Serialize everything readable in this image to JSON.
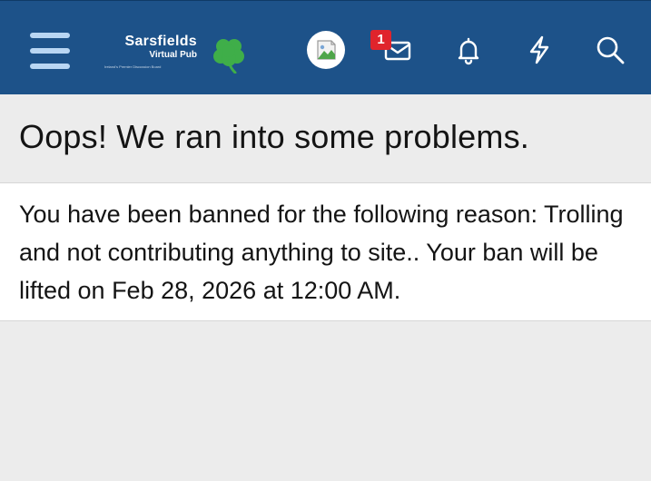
{
  "header": {
    "logo": {
      "title": "Sarsfields",
      "subtitle": "Virtual Pub",
      "tagline": "Ireland's Premier Discussion Board",
      "mark": "shamrock-icon"
    },
    "menu_icon": "hamburger-menu-icon",
    "avatar_icon": "broken-image-avatar",
    "icons": [
      "inbox-icon",
      "bell-icon",
      "lightning-icon",
      "search-icon"
    ],
    "inbox_badge": "1",
    "colors": {
      "bar": "#1d5289",
      "badge": "#e0242c",
      "shamrock": "#3fae49"
    }
  },
  "error": {
    "title": "Oops! We ran into some problems.",
    "message": "You have been banned for the following reason: Trolling and not contributing anything to site.. Your ban will be lifted on Feb 28, 2026 at 12:00 AM."
  }
}
